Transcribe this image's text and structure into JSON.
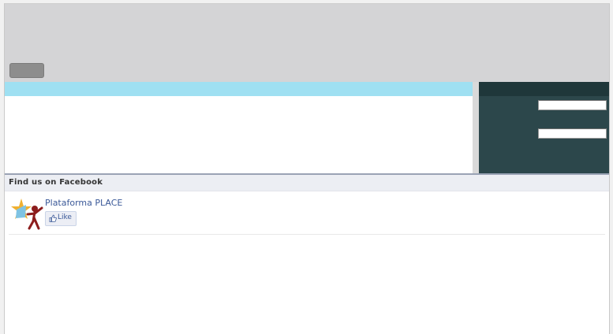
{
  "facebook": {
    "section_title": "Find us on Facebook",
    "page_name": "Plataforma PLACE",
    "like_label": "Like"
  },
  "colors": {
    "header_bg": "#d4d4d6",
    "content_bar": "#9fe0f2",
    "side_panel": "#2c474b",
    "side_panel_head": "#1f373a",
    "facebook_blue": "#3b5998"
  },
  "icons": {
    "logo": "plataforma-place-logo-icon",
    "like": "thumbs-up-icon"
  }
}
